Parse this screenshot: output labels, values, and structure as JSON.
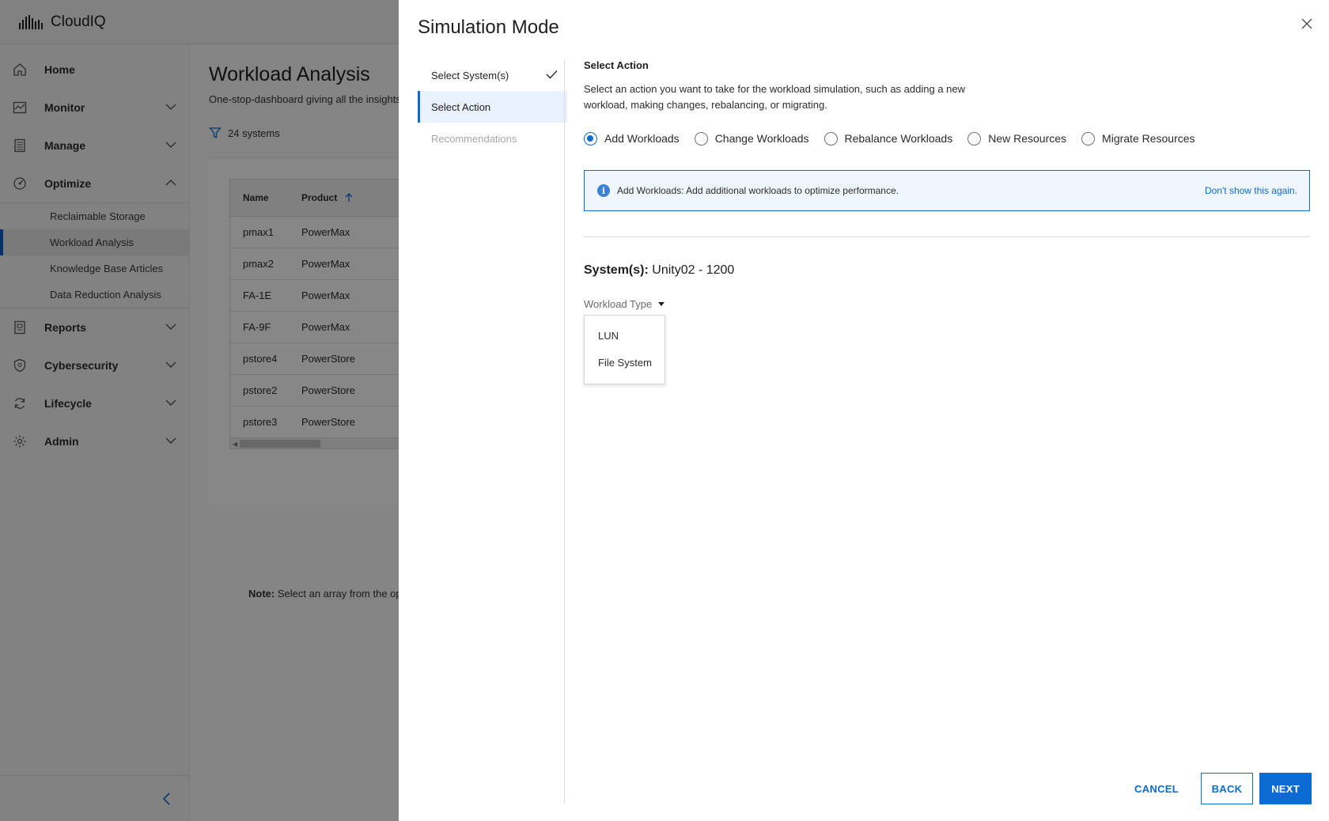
{
  "app": {
    "name": "CloudIQ"
  },
  "sidebar": {
    "items": [
      {
        "label": "Home",
        "icon": "home-icon"
      },
      {
        "label": "Monitor",
        "icon": "monitor-icon"
      },
      {
        "label": "Manage",
        "icon": "manage-icon"
      },
      {
        "label": "Optimize",
        "icon": "optimize-icon"
      },
      {
        "label": "Reports",
        "icon": "reports-icon"
      },
      {
        "label": "Cybersecurity",
        "icon": "shield-icon"
      },
      {
        "label": "Lifecycle",
        "icon": "lifecycle-icon"
      },
      {
        "label": "Admin",
        "icon": "gear-icon"
      }
    ],
    "optimize_sub": [
      {
        "label": "Reclaimable Storage"
      },
      {
        "label": "Workload Analysis"
      },
      {
        "label": "Knowledge Base Articles"
      },
      {
        "label": "Data Reduction Analysis"
      }
    ]
  },
  "page": {
    "title": "Workload Analysis",
    "subtitle": "One-stop-dashboard giving all the insights",
    "filter_count": "24 systems",
    "table": {
      "headers": {
        "name": "Name",
        "product": "Product"
      },
      "rows": [
        {
          "name": "pmax1",
          "product": "PowerMax"
        },
        {
          "name": "pmax2",
          "product": "PowerMax"
        },
        {
          "name": "FA-1E",
          "product": "PowerMax"
        },
        {
          "name": "FA-9F",
          "product": "PowerMax"
        },
        {
          "name": "pstore4",
          "product": "PowerStore"
        },
        {
          "name": "pstore2",
          "product": "PowerStore"
        },
        {
          "name": "pstore3",
          "product": "PowerStore"
        }
      ]
    },
    "note_label": "Note:",
    "note_text": "Select an array from the option"
  },
  "drawer": {
    "title": "Simulation Mode",
    "steps": [
      {
        "label": "Select System(s)",
        "state": "done"
      },
      {
        "label": "Select Action",
        "state": "active"
      },
      {
        "label": "Recommendations",
        "state": "disabled"
      }
    ],
    "section_title": "Select Action",
    "section_desc": "Select an action you want to take for the workload simulation, such as adding a new workload, making changes, rebalancing, or migrating.",
    "actions": [
      {
        "label": "Add Workloads",
        "selected": true
      },
      {
        "label": "Change Workloads",
        "selected": false
      },
      {
        "label": "Rebalance Workloads",
        "selected": false
      },
      {
        "label": "New Resources",
        "selected": false
      },
      {
        "label": "Migrate Resources",
        "selected": false
      }
    ],
    "info": {
      "text": "Add Workloads: Add additional workloads to optimize performance.",
      "dismiss": "Don't show this again."
    },
    "systems_label": "System(s):",
    "systems_value": "Unity02 - 1200",
    "workload_type": {
      "label": "Workload Type",
      "options": [
        "LUN",
        "File System"
      ]
    },
    "buttons": {
      "cancel": "CANCEL",
      "back": "BACK",
      "next": "NEXT"
    }
  },
  "colors": {
    "accent": "#0b6bd1",
    "overlay": "rgba(0,0,0,0.47)"
  }
}
